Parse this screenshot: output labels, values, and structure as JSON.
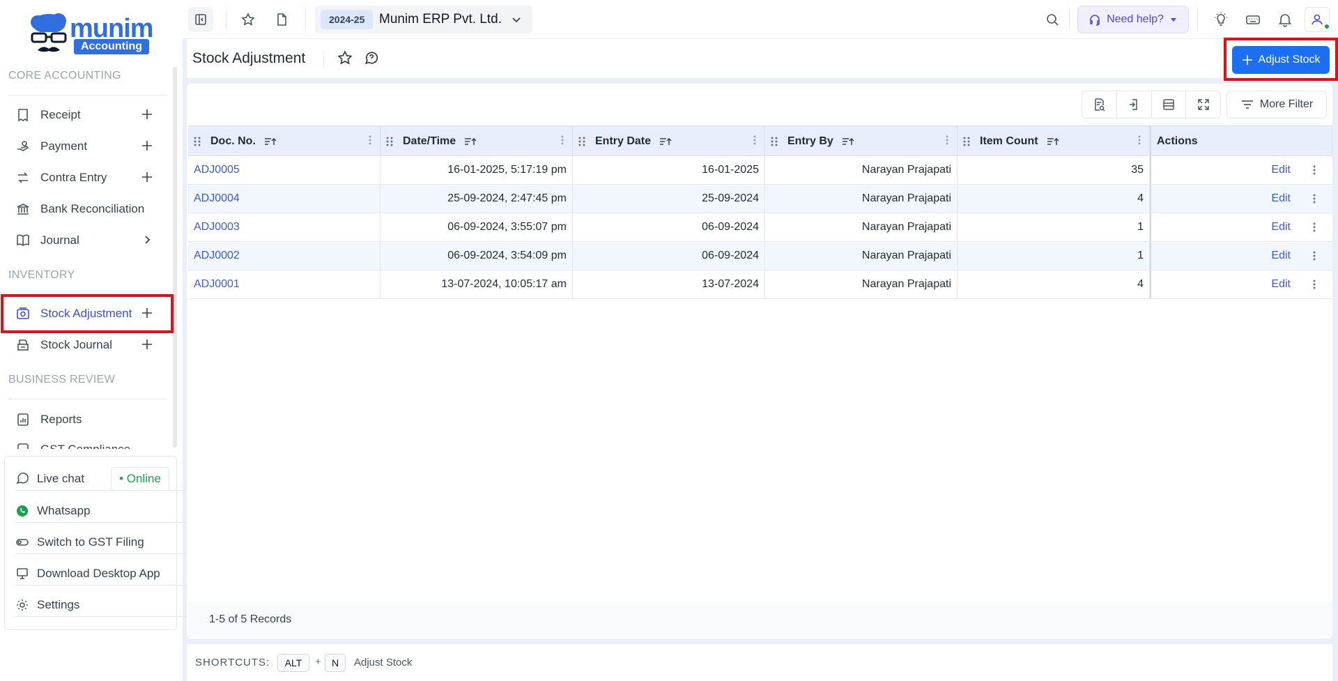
{
  "logo": {
    "word": "munim",
    "sub": "Accounting"
  },
  "sidebar": {
    "sections": [
      {
        "title": "CORE ACCOUNTING"
      },
      {
        "title": "INVENTORY"
      },
      {
        "title": "BUSINESS REVIEW"
      }
    ],
    "items": [
      {
        "label": "Receipt",
        "icon": "receipt-icon",
        "trail": "plus"
      },
      {
        "label": "Payment",
        "icon": "payment-icon",
        "trail": "plus"
      },
      {
        "label": "Contra Entry",
        "icon": "contra-icon",
        "trail": "plus"
      },
      {
        "label": "Bank Reconciliation",
        "icon": "bank-icon",
        "trail": ""
      },
      {
        "label": "Journal",
        "icon": "book-icon",
        "trail": "chevron"
      },
      {
        "label": "Stock Adjustment",
        "icon": "stock-adjust-icon",
        "trail": "plus"
      },
      {
        "label": "Stock Journal",
        "icon": "stock-journal-icon",
        "trail": "plus"
      },
      {
        "label": "Reports",
        "icon": "reports-icon",
        "trail": ""
      },
      {
        "label": "GST Compliance",
        "icon": "gst-icon",
        "trail": ""
      }
    ],
    "bottom": {
      "live_chat": "Live chat",
      "online": "• Online",
      "whatsapp": "Whatsapp",
      "switch_gst": "Switch to GST Filing",
      "download": "Download Desktop App",
      "settings": "Settings"
    }
  },
  "topbar": {
    "year": "2024-25",
    "company": "Munim ERP Pvt. Ltd.",
    "help": "Need help?"
  },
  "page": {
    "title": "Stock Adjustment",
    "primary_button": "Adjust Stock",
    "more_filter": "More Filter"
  },
  "table": {
    "columns": [
      "Doc. No.",
      "Date/Time",
      "Entry Date",
      "Entry By",
      "Item Count",
      "Actions"
    ],
    "action_label": "Edit",
    "rows": [
      {
        "doc": "ADJ0005",
        "datetime": "16-01-2025, 5:17:19 pm",
        "entry_date": "16-01-2025",
        "entry_by": "Narayan Prajapati",
        "count": "35"
      },
      {
        "doc": "ADJ0004",
        "datetime": "25-09-2024, 2:47:45 pm",
        "entry_date": "25-09-2024",
        "entry_by": "Narayan Prajapati",
        "count": "4"
      },
      {
        "doc": "ADJ0003",
        "datetime": "06-09-2024, 3:55:07 pm",
        "entry_date": "06-09-2024",
        "entry_by": "Narayan Prajapati",
        "count": "1"
      },
      {
        "doc": "ADJ0002",
        "datetime": "06-09-2024, 3:54:09 pm",
        "entry_date": "06-09-2024",
        "entry_by": "Narayan Prajapati",
        "count": "1"
      },
      {
        "doc": "ADJ0001",
        "datetime": "13-07-2024, 10:05:17 am",
        "entry_date": "13-07-2024",
        "entry_by": "Narayan Prajapati",
        "count": "4"
      }
    ],
    "records": "1-5 of 5 Records"
  },
  "shortcuts": {
    "label": "SHORTCUTS:",
    "key1": "ALT",
    "plus": "+",
    "key2": "N",
    "desc": "Adjust Stock"
  },
  "colors": {
    "accent": "#1d6ff2",
    "highlight": "#e0101a",
    "link": "#3b5bdb"
  }
}
